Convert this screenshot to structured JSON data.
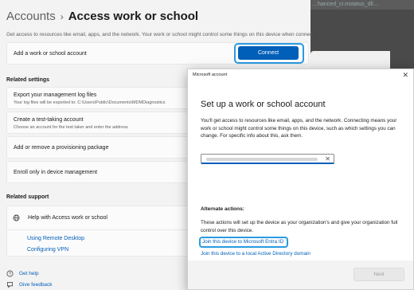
{
  "desktop": {
    "title_fragment": "…hanced_cr.mstatus_dll…"
  },
  "settings": {
    "breadcrumb": {
      "parent": "Accounts",
      "separator": "›",
      "current": "Access work or school"
    },
    "description": "Get access to resources like email, apps, and the network. Your work or school might control some things on this device when connected.",
    "add_account": {
      "label": "Add a work or school account",
      "button": "Connect"
    },
    "related_settings": {
      "heading": "Related settings",
      "items": [
        {
          "title": "Export your management log files",
          "subtitle": "Your log files will be exported to: C:\\Users\\Public\\Documents\\MDMDiagnostics"
        },
        {
          "title": "Create a test-taking account",
          "subtitle": "Choose an account for the test taker and enter the address"
        },
        {
          "title": "Add or remove a provisioning package",
          "subtitle": ""
        },
        {
          "title": "Enroll only in device management",
          "subtitle": ""
        }
      ]
    },
    "related_support": {
      "heading": "Related support",
      "help_item": "Help with Access work or school",
      "links": [
        "Using Remote Desktop",
        "Configuring VPN"
      ]
    },
    "footer": {
      "get_help": "Get help",
      "give_feedback": "Give feedback"
    }
  },
  "dialog": {
    "title": "Microsoft account",
    "close_icon": "✕",
    "heading": "Set up a work or school account",
    "body": "You'll get access to resources like email, apps, and the network. Connecting means your work or school might control some things on this device, such as which settings you can change. For specific info about this, ask them.",
    "input_clear": "✕",
    "alternate_heading": "Alternate actions:",
    "alternate_body": "These actions will set up the device as your organization's and give your organization full control over this device.",
    "join_entra": "Join this device to Microsoft Entra ID",
    "join_ad": "Join this device to a local Active Directory domain",
    "next_button": "Next"
  }
}
